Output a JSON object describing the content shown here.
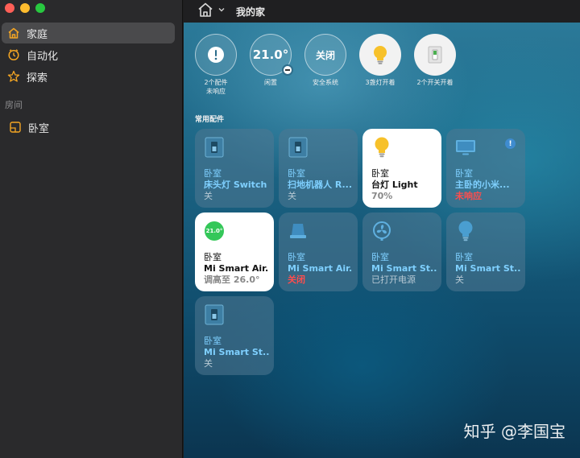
{
  "window": {
    "title": "我的家",
    "traffic": {
      "red": "#ff5f57",
      "yellow": "#febc2e",
      "green": "#28c840"
    }
  },
  "sidebar": {
    "items": [
      {
        "label": "家庭",
        "icon": "house-icon",
        "active": true
      },
      {
        "label": "自动化",
        "icon": "clock-icon",
        "active": false
      },
      {
        "label": "探索",
        "icon": "star-icon",
        "active": false
      }
    ],
    "rooms_label": "房间",
    "rooms": [
      {
        "label": "卧室",
        "icon": "room-icon"
      }
    ]
  },
  "status": [
    {
      "value": "!",
      "label": "2个配件\n未响应"
    },
    {
      "value": "21.0°",
      "label": "闲置"
    },
    {
      "value": "关闭",
      "label": "安全系统"
    },
    {
      "value": "",
      "label": "3盏灯开着",
      "icon": "bulb-icon"
    },
    {
      "value": "",
      "label": "2个开关开着",
      "icon": "switch-icon"
    }
  ],
  "section_title": "常用配件",
  "tiles": [
    {
      "room": "卧室",
      "name": "床头灯 Switch",
      "state": "关",
      "icon": "switch-icon",
      "on": false
    },
    {
      "room": "卧室",
      "name": "扫地机器人 R...",
      "state": "关",
      "icon": "switch-icon",
      "on": false
    },
    {
      "room": "卧室",
      "name": "台灯 Light",
      "state": "70%",
      "icon": "bulb-icon",
      "on": true
    },
    {
      "room": "卧室",
      "name": "主卧的小米...",
      "state": "未响应",
      "icon": "tv-icon",
      "on": false,
      "warn": true
    },
    {
      "room": "卧室",
      "name": "Mi Smart Air...",
      "state": "调高至 26.0°",
      "icon": "thermostat-icon",
      "temp": "21.0°",
      "on": true
    },
    {
      "room": "卧室",
      "name": "Mi Smart Air...",
      "state": "关闭",
      "icon": "humidifier-icon",
      "on": false,
      "warn": true
    },
    {
      "room": "卧室",
      "name": "Mi Smart St...",
      "state": "已打开电源",
      "icon": "fan-icon",
      "on": false
    },
    {
      "room": "卧室",
      "name": "Mi Smart St...",
      "state": "关",
      "icon": "bulb-icon",
      "on": false
    },
    {
      "room": "卧室",
      "name": "Mi Smart St...",
      "state": "关",
      "icon": "switch-icon",
      "on": false
    }
  ],
  "watermark": "知乎 @李国宝",
  "colors": {
    "accent_orange": "#f5a623",
    "tile_label_blue": "#7fd0ff",
    "warning_red": "#ff4d4d",
    "bulb_yellow": "#f7c12a"
  }
}
